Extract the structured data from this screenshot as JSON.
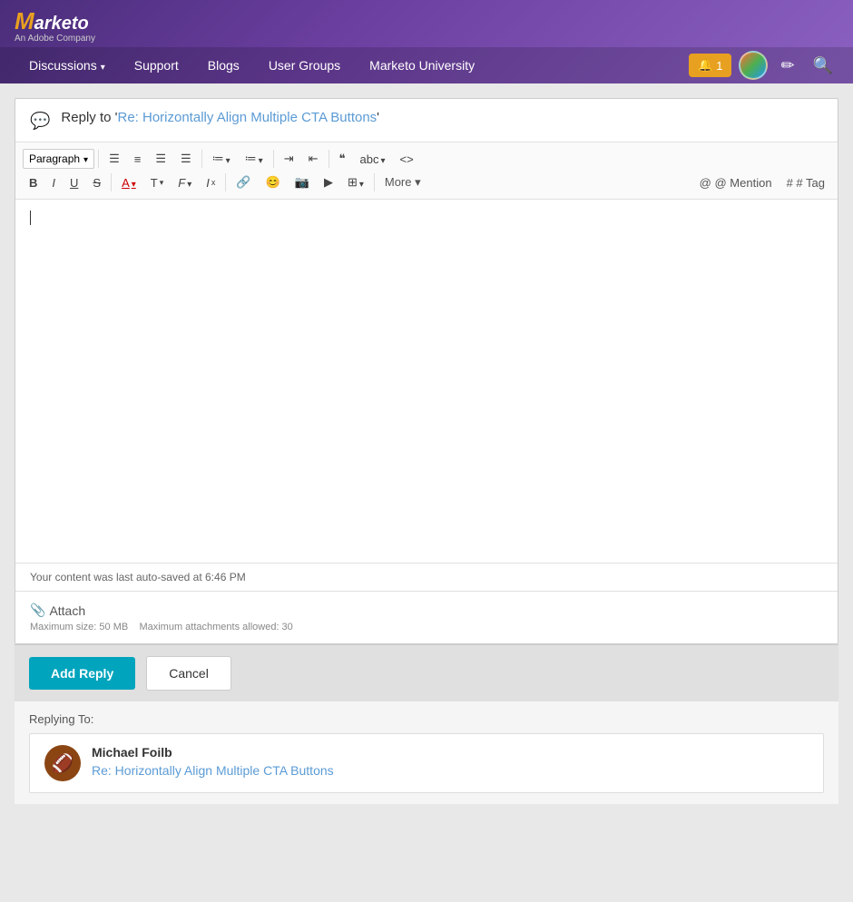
{
  "header": {
    "logo": "Marketo",
    "logo_sub": "An Adobe Company",
    "nav": [
      {
        "label": "Discussions",
        "has_dropdown": true
      },
      {
        "label": "Support",
        "has_dropdown": false
      },
      {
        "label": "Blogs",
        "has_dropdown": false
      },
      {
        "label": "User Groups",
        "has_dropdown": false
      },
      {
        "label": "Marketo University",
        "has_dropdown": false
      }
    ],
    "notification_count": "1",
    "notification_label": "🔔 1",
    "edit_icon": "✏",
    "search_icon": "🔍"
  },
  "editor": {
    "title_prefix": "Reply to '",
    "title_link": "Re: Horizontally Align Multiple CTA Buttons",
    "title_suffix": "'",
    "paragraph_label": "Paragraph",
    "toolbar_row1": [
      {
        "label": "≡",
        "title": "align-left"
      },
      {
        "label": "≡",
        "title": "align-center"
      },
      {
        "label": "≡",
        "title": "align-right"
      },
      {
        "label": "≡",
        "title": "align-justify"
      },
      {
        "label": "≡▾",
        "title": "list-unordered"
      },
      {
        "label": "≡▾",
        "title": "list-ordered"
      },
      {
        "label": "→",
        "title": "indent"
      },
      {
        "label": "←",
        "title": "outdent"
      },
      {
        "label": "❝❞",
        "title": "blockquote"
      },
      {
        "label": "abc▾",
        "title": "spellcheck"
      },
      {
        "label": "<>",
        "title": "source"
      }
    ],
    "toolbar_row2": [
      {
        "label": "B",
        "title": "bold",
        "class": "bold"
      },
      {
        "label": "I",
        "title": "italic",
        "class": "italic"
      },
      {
        "label": "U",
        "title": "underline",
        "class": "underline"
      },
      {
        "label": "S",
        "title": "strikethrough",
        "class": "strikethrough"
      },
      {
        "label": "A",
        "title": "font-color",
        "class": "color-a"
      },
      {
        "label": "T▾",
        "title": "text-size"
      },
      {
        "label": "F▾",
        "title": "font-family"
      },
      {
        "label": "Ix",
        "title": "clear-format"
      },
      {
        "label": "🔗",
        "title": "link"
      },
      {
        "label": "😊",
        "title": "emoji"
      },
      {
        "label": "📷",
        "title": "image"
      },
      {
        "label": "▶",
        "title": "video"
      },
      {
        "label": "⊞▾",
        "title": "table"
      },
      {
        "label": "More ▾",
        "title": "more"
      }
    ],
    "mention_label": "@ Mention",
    "tag_label": "# Tag",
    "autosave_text": "Your content was last auto-saved at 6:46 PM",
    "attach_label": "Attach",
    "attach_max_size": "Maximum size: 50 MB",
    "attach_max_count": "Maximum attachments allowed: 30"
  },
  "actions": {
    "add_reply_label": "Add Reply",
    "cancel_label": "Cancel"
  },
  "replying_to": {
    "label": "Replying To:",
    "author": "Michael Foilb",
    "post_title": "Re: Horizontally Align Multiple CTA Buttons",
    "avatar_emoji": "🏈"
  }
}
